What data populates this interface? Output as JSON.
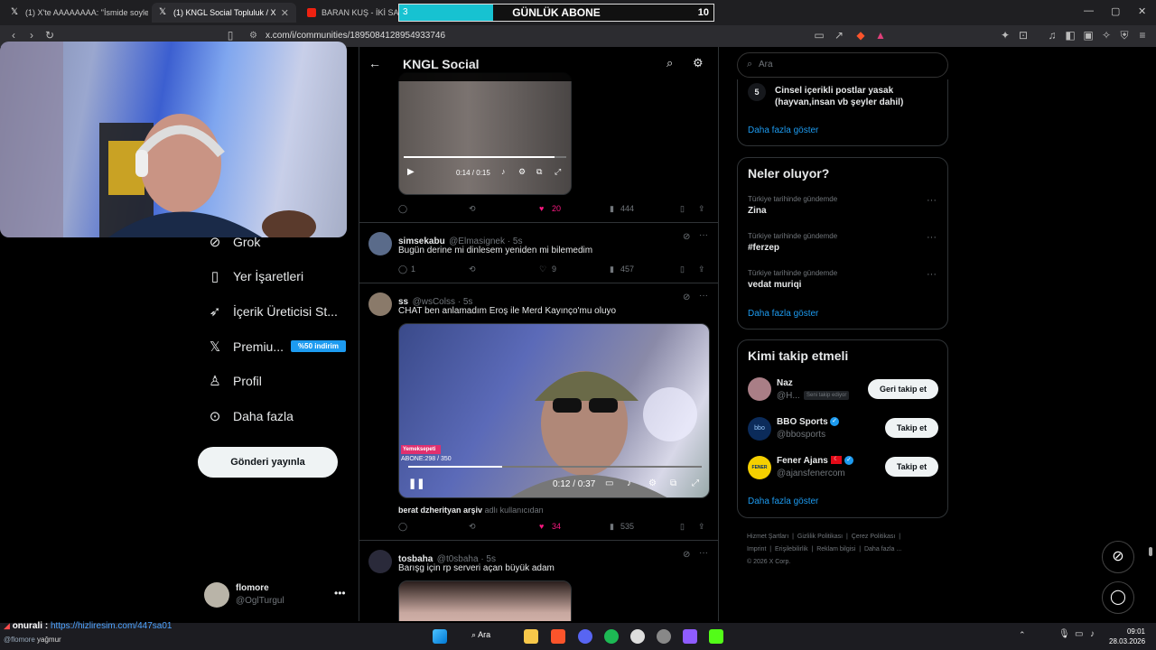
{
  "browser": {
    "tabs": [
      {
        "title": "(1) X'te AAAAAAAA: \"İsmide soylendi"
      },
      {
        "title": "(1) KNGL Social Topluluk / X"
      },
      {
        "title": "BARAN KUŞ - İKİ SARIŞIN"
      }
    ],
    "url": "x.com/i/communities/1895084128954933746"
  },
  "overlay": {
    "sub_title": "GÜNLÜK ABONE",
    "sub_current": "3",
    "sub_goal": "10",
    "sub_progress": 0.3
  },
  "nav": {
    "items": [
      {
        "label": "Grok",
        "icon": "grok-icon"
      },
      {
        "label": "Yer İşaretleri",
        "icon": "bookmark-icon"
      },
      {
        "label": "İçerik Üreticisi St...",
        "icon": "rocket-icon"
      },
      {
        "label": "Premiu...",
        "icon": "x-logo-icon"
      },
      {
        "label": "Profil",
        "icon": "person-icon"
      },
      {
        "label": "Daha fazla",
        "icon": "more-circle-icon"
      }
    ],
    "premium_badge": "%50 indirim",
    "post_button": "Gönderi yayınla",
    "account": {
      "name": "flomore",
      "handle": "@OglTurgul"
    }
  },
  "community": {
    "title": "KNGL Social"
  },
  "posts": [
    {
      "video_time": "0:14 / 0:15",
      "video_progress": 0.93,
      "replies": "",
      "reposts": "",
      "likes": "20",
      "views": "444"
    },
    {
      "name": "simsekabu",
      "handle": "@Elmasignek · 5s",
      "text": "Bugün derine mi dinlesem yeniden mi bilemedim",
      "replies": "1",
      "reposts": "",
      "likes": "9",
      "views": "457"
    },
    {
      "name": "ss",
      "handle": "@wsColss · 5s",
      "text": "CHAT ben anlamadım Eroş ile Merd Kayınço'mu oluyo",
      "video_time": "0:12 / 0:37",
      "video_progress": 0.32,
      "video_overlay_tag": "Yemeksepeti",
      "video_overlay_text": "ABONE:298 / 350",
      "attribution_name": "berat dzherityan arşiv",
      "attribution_suffix": "adlı kullanıcıdan",
      "replies": "",
      "reposts": "",
      "likes": "34",
      "views": "535"
    },
    {
      "name": "tosbaha",
      "handle": "@t0sbaha · 5s",
      "text": "Barışg için rp serveri açan büyük adam"
    }
  ],
  "sidebar": {
    "search_placeholder": "Ara",
    "rules": {
      "number": "5",
      "text": "Cinsel içerikli postlar yasak (hayvan,insan vb şeyler dahil)",
      "more": "Daha fazla göster"
    },
    "trends": {
      "title": "Neler oluyor?",
      "items": [
        {
          "context": "Türkiye tarihinde gündemde",
          "name": "Zina"
        },
        {
          "context": "Türkiye tarihinde gündemde",
          "name": "#ferzep"
        },
        {
          "context": "Türkiye tarihinde gündemde",
          "name": "vedat muriqi"
        }
      ],
      "more": "Daha fazla göster"
    },
    "who_to_follow": {
      "title": "Kimi takip etmeli",
      "items": [
        {
          "name": "Naz",
          "handle": "@H...",
          "badge": "Seni takip ediyor",
          "button": "Geri takip et",
          "verified": false
        },
        {
          "name": "BBO Sports",
          "handle": "@bbosports",
          "button": "Takip et",
          "verified": true
        },
        {
          "name": "Fener Ajans",
          "handle": "@ajansfenercom",
          "button": "Takip et",
          "verified": true
        }
      ],
      "more": "Daha fazla göster"
    },
    "footer": {
      "links": [
        "Hizmet Şartları",
        "Gizlilik Politikası",
        "Çerez Politikası",
        "Imprint",
        "Erişilebilirlik",
        "Reklam bilgisi",
        "Daha fazla ..."
      ],
      "copyright": "© 2026 X Corp."
    }
  },
  "chat": {
    "user": "onurali :",
    "link": "https://hizliresim.com/447sa01",
    "user2": "@flomore",
    "text2": "yağmur"
  },
  "taskbar": {
    "search": "Ara",
    "time": "09:01",
    "date": "28.03.2026"
  }
}
